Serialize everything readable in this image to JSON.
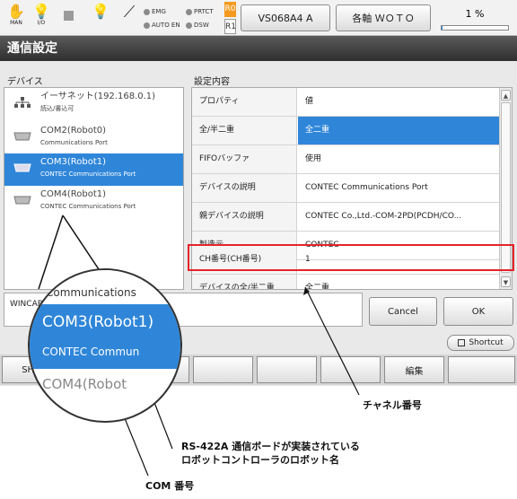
{
  "status_bar": {
    "icons": [
      {
        "name": "man-mode-icon",
        "label": "MAN"
      },
      {
        "name": "io-icon",
        "label": "I/O"
      },
      {
        "name": "stop-icon",
        "label": ""
      },
      {
        "name": "lamp-icon",
        "label": ""
      },
      {
        "name": "wrench-icon",
        "label": ""
      }
    ],
    "indicators": {
      "emg": "EMG",
      "auto_en": "AUTO EN",
      "prtct": "PRTCT",
      "dsw": "DSW"
    },
    "r0": "R0",
    "r1": "R1",
    "robot_button": "VS068A4 A",
    "axis_button": "各軸 ＷＯＴＯ",
    "speed": "1 %",
    "speed_fraction": 0.01
  },
  "title": "通信設定",
  "devices_label": "デバイス",
  "settings_label": "設定内容",
  "devices": [
    {
      "name": "イーサネット(192.168.0.1)",
      "sub": "読込/書込可",
      "icon": "ethernet-icon"
    },
    {
      "name": "COM2(Robot0)",
      "sub": "Communications Port",
      "icon": "serial-port-icon"
    },
    {
      "name": "COM3(Robot1)",
      "sub": "CONTEC Communications Port",
      "icon": "serial-port-icon"
    },
    {
      "name": "COM4(Robot1)",
      "sub": "CONTEC Communications Port",
      "icon": "serial-port-icon"
    }
  ],
  "properties": [
    {
      "key": "プロパティ",
      "value": "値"
    },
    {
      "key": "全/半二重",
      "value": "全二重"
    },
    {
      "key": "FIFOバッファ",
      "value": "使用"
    },
    {
      "key": "デバイスの説明",
      "value": "CONTEC Communications Port"
    },
    {
      "key": "親デバイスの説明",
      "value": "CONTEC Co.,Ltd.-COM-2PD(PCDH/CO..."
    },
    {
      "key": "製造元",
      "value": "CONTEC"
    },
    {
      "key": "CH番号(CH番号)",
      "value": "1"
    },
    {
      "key": "デバイスの全/半二重",
      "value": "全二重"
    }
  ],
  "description": "WINCAP 通信を行うための設定です。",
  "buttons": {
    "cancel": "Cancel",
    "ok": "OK"
  },
  "shortcut": "Shortcut",
  "fkeys": [
    "SHIF",
    "",
    "",
    "",
    "",
    "",
    "編集",
    ""
  ],
  "magnifier": {
    "line1": "Communications",
    "line2": "COM3(Robot1)",
    "line3": "CONTEC Commun",
    "line4": "COM4(Robot"
  },
  "callouts": {
    "channel": "チャネル番号",
    "robot_name_1": "RS-422A 通信ボードが実装されている",
    "robot_name_2": "ロボットコントローラのロボット名",
    "com_no": "COM 番号"
  },
  "colors": {
    "selection": "#2f86d9",
    "highlight_border": "#e5242a",
    "title_bar": "#3a3a3a",
    "r0_bg": "#f39a1e"
  }
}
